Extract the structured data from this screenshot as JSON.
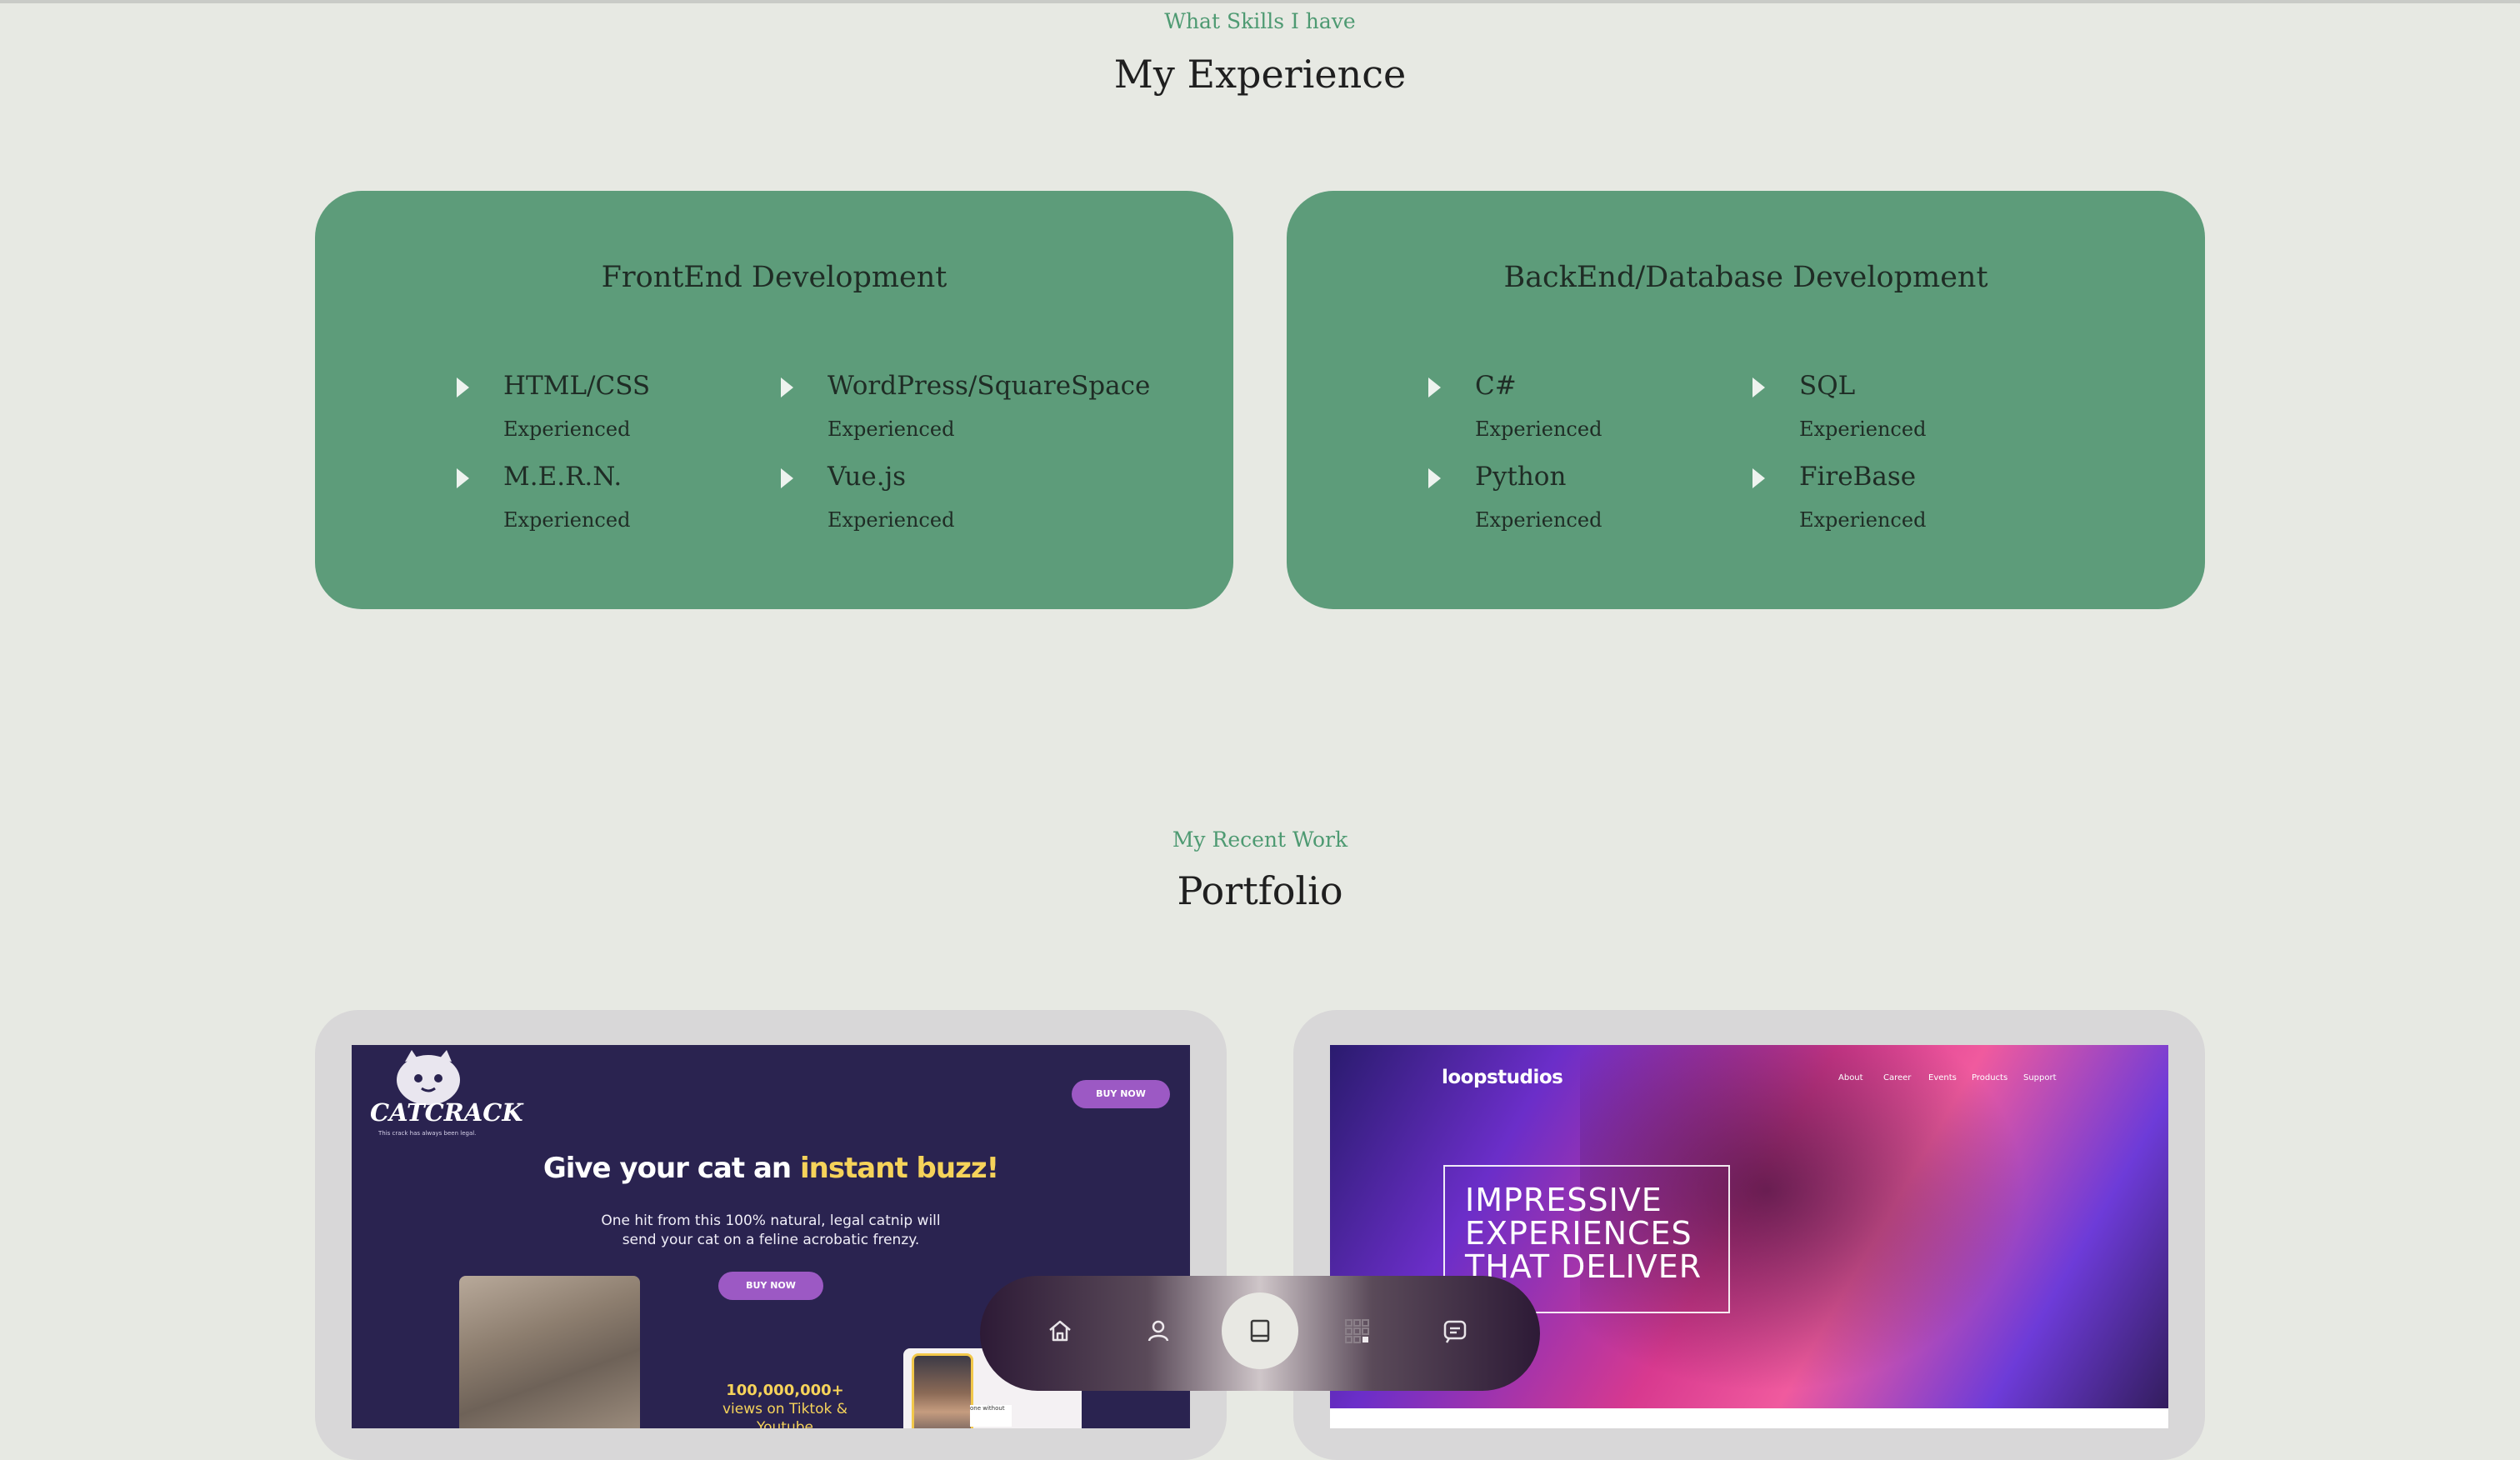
{
  "experience": {
    "subtitle": "What Skills I have",
    "title": "My Experience",
    "cards": [
      {
        "title": "FrontEnd Development",
        "skills": [
          {
            "name": "HTML/CSS",
            "level": "Experienced"
          },
          {
            "name": "WordPress/SquareSpace",
            "level": "Experienced"
          },
          {
            "name": "M.E.R.N.",
            "level": "Experienced"
          },
          {
            "name": "Vue.js",
            "level": "Experienced"
          }
        ]
      },
      {
        "title": "BackEnd/Database Development",
        "skills": [
          {
            "name": "C#",
            "level": "Experienced"
          },
          {
            "name": "SQL",
            "level": "Experienced"
          },
          {
            "name": "Python",
            "level": "Experienced"
          },
          {
            "name": "FireBase",
            "level": "Experienced"
          }
        ]
      }
    ]
  },
  "portfolio": {
    "subtitle": "My Recent Work",
    "title": "Portfolio",
    "items": [
      {
        "brand": "CATCRACK",
        "tagline": "This crack has always been legal.",
        "buy_label": "BUY NOW",
        "headline_start": "Give your cat an ",
        "headline_highlight": "instant buzz!",
        "body": "One hit from this 100% natural, legal catnip will send your cat on a feline acrobatic frenzy.",
        "stat_value": "100,000,000+",
        "stat_text": "views on Tiktok & Youtube",
        "mini_text": "one without"
      },
      {
        "brand": "loopstudios",
        "nav": [
          "About",
          "Career",
          "Events",
          "Products",
          "Support"
        ],
        "hero_lines": [
          "IMPRESSIVE",
          "EXPERIENCES",
          "THAT DELIVER"
        ]
      }
    ]
  },
  "dock": {
    "buttons": [
      {
        "icon": "home-icon",
        "active": false
      },
      {
        "icon": "user-icon",
        "active": false
      },
      {
        "icon": "book-icon",
        "active": true
      },
      {
        "icon": "grid-icon",
        "active": false
      },
      {
        "icon": "message-icon",
        "active": false
      }
    ]
  },
  "colors": {
    "background": "#e7e9e3",
    "card": "#5d9c7a",
    "accent": "#4e9a72"
  }
}
